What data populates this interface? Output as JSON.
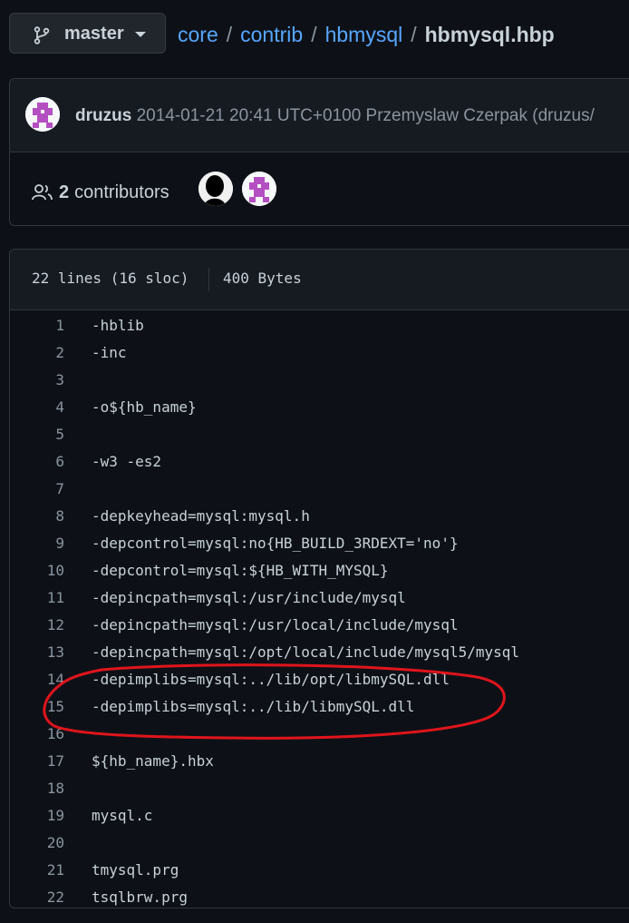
{
  "branch": {
    "name": "master"
  },
  "breadcrumb": {
    "parts": [
      "core",
      "contrib",
      "hbmysql"
    ],
    "separator": "/",
    "file": "hbmysql.hbp"
  },
  "commit": {
    "author": "druzus",
    "meta": "2014-01-21 20:41 UTC+0100 Przemyslaw Czerpak (druzus/"
  },
  "contributors": {
    "count": "2",
    "label": "contributors"
  },
  "file": {
    "lines_info": "22 lines (16 sloc)",
    "size": "400 Bytes"
  },
  "code": {
    "lines": [
      {
        "n": "1",
        "text": "-hblib"
      },
      {
        "n": "2",
        "text": "-inc"
      },
      {
        "n": "3",
        "text": ""
      },
      {
        "n": "4",
        "text": "-o${hb_name}"
      },
      {
        "n": "5",
        "text": ""
      },
      {
        "n": "6",
        "text": "-w3 -es2"
      },
      {
        "n": "7",
        "text": ""
      },
      {
        "n": "8",
        "text": "-depkeyhead=mysql:mysql.h"
      },
      {
        "n": "9",
        "text": "-depcontrol=mysql:no{HB_BUILD_3RDEXT='no'}"
      },
      {
        "n": "10",
        "text": "-depcontrol=mysql:${HB_WITH_MYSQL}"
      },
      {
        "n": "11",
        "text": "-depincpath=mysql:/usr/include/mysql"
      },
      {
        "n": "12",
        "text": "-depincpath=mysql:/usr/local/include/mysql"
      },
      {
        "n": "13",
        "text": "-depincpath=mysql:/opt/local/include/mysql5/mysql"
      },
      {
        "n": "14",
        "text": "-depimplibs=mysql:../lib/opt/libmySQL.dll"
      },
      {
        "n": "15",
        "text": "-depimplibs=mysql:../lib/libmySQL.dll"
      },
      {
        "n": "16",
        "text": ""
      },
      {
        "n": "17",
        "text": "${hb_name}.hbx"
      },
      {
        "n": "18",
        "text": ""
      },
      {
        "n": "19",
        "text": "mysql.c"
      },
      {
        "n": "20",
        "text": ""
      },
      {
        "n": "21",
        "text": "tmysql.prg"
      },
      {
        "n": "22",
        "text": "tsqlbrw.prg"
      }
    ]
  },
  "colors": {
    "background": "#0d1117",
    "link": "#58a6ff",
    "text": "#c9d1d9",
    "muted": "#8b949e",
    "border": "#30363d",
    "annotation": "#e0141c",
    "identicon": "#b44fc2"
  },
  "icons": [
    "git-branch-icon",
    "caret-down-icon",
    "people-icon"
  ]
}
